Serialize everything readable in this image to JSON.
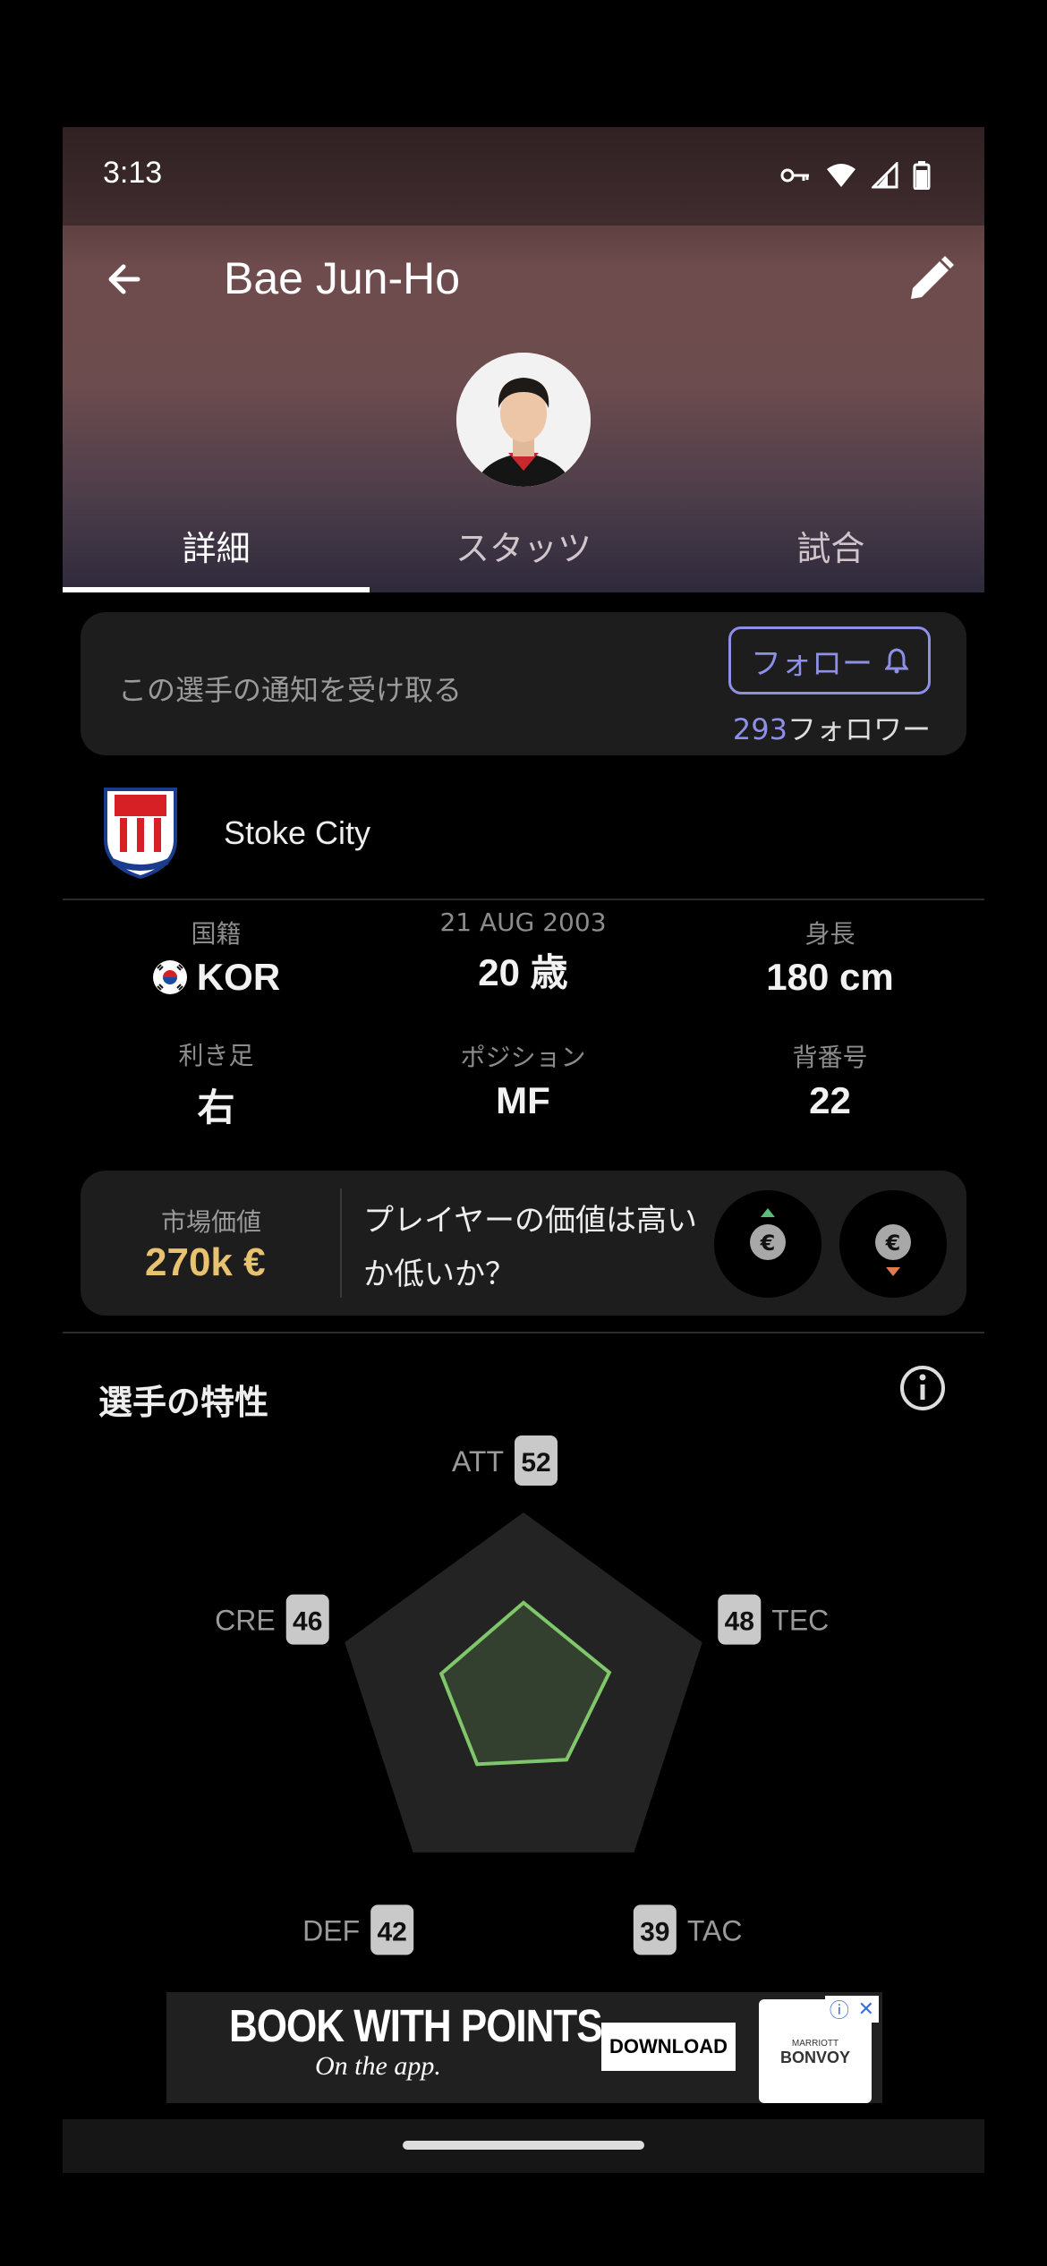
{
  "status": {
    "time": "3:13"
  },
  "header": {
    "title": "Bae Jun-Ho"
  },
  "tabs": [
    {
      "label": "詳細",
      "active": true
    },
    {
      "label": "スタッツ",
      "active": false
    },
    {
      "label": "試合",
      "active": false
    }
  ],
  "follow": {
    "prompt": "この選手の通知を受け取る",
    "button_label": "フォロー",
    "followers_count": "293",
    "followers_label": "フォロワー"
  },
  "club": {
    "name": "Stoke City"
  },
  "info": {
    "nationality": {
      "label": "国籍",
      "value": "KOR"
    },
    "age": {
      "label": "21 AUG 2003",
      "value": "20 歳"
    },
    "height": {
      "label": "身長",
      "value": "180 cm"
    },
    "foot": {
      "label": "利き足",
      "value": "右"
    },
    "position": {
      "label": "ポジション",
      "value": "MF"
    },
    "number": {
      "label": "背番号",
      "value": "22"
    }
  },
  "market": {
    "label": "市場価値",
    "value": "270k €",
    "question": "プレイヤーの価値は高いか低いか？"
  },
  "traits": {
    "title": "選手の特性",
    "attributes": [
      {
        "key": "ATT",
        "value": 52
      },
      {
        "key": "TEC",
        "value": 48
      },
      {
        "key": "TAC",
        "value": 39
      },
      {
        "key": "DEF",
        "value": 42
      },
      {
        "key": "CRE",
        "value": 46
      }
    ],
    "max": 100
  },
  "ad": {
    "headline": "BOOK WITH POINTS",
    "subline": "On the app.",
    "cta": "DOWNLOAD",
    "brand_top": "MARRIOTT",
    "brand": "BONVOY"
  },
  "colors": {
    "accent": "#8e8fe6",
    "market_value": "#e8c26f",
    "radar_line": "#7fc76a",
    "arrow_up": "#5dbb7a",
    "arrow_down": "#e07a4f"
  }
}
